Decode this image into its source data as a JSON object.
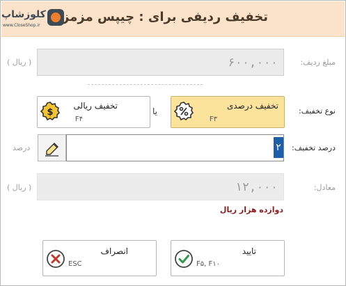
{
  "header": {
    "title": "تخفیف ردیفی برای : چیپس مزمز",
    "logo_text": "کلوزشاپ",
    "logo_sub": "www.CloseShop.ir"
  },
  "row_amount": {
    "label": "مبلغ ردیف:",
    "value": "۶۰۰,۰۰۰",
    "unit": "( ریال )"
  },
  "discount_type": {
    "label": "نوع تخفیف:",
    "or": "یا",
    "percent": {
      "label": "تخفیف درصدی",
      "key": "F۳",
      "selected": true
    },
    "rial": {
      "label": "تخفیف ریالی",
      "key": "F۴",
      "selected": false
    }
  },
  "discount_percent": {
    "label": "درصد تخفیف:",
    "value": "۲",
    "unit": "درصد"
  },
  "equivalent": {
    "label": "معادل:",
    "value": "۱۲,۰۰۰",
    "unit": "( ریال )",
    "words": "دوازده هزار  ریال"
  },
  "buttons": {
    "confirm": {
      "label": "تایید",
      "key": "F۵, F۱۰"
    },
    "cancel": {
      "label": "انصراف",
      "key": "ESC"
    }
  },
  "colors": {
    "header_bg": "#fbe3cb",
    "selected_option_bg": "#fbe39c",
    "words_color": "#8b1a1a",
    "confirm_green": "#2e9a4a",
    "cancel_red": "#c0392b",
    "caret_blue": "#1d5fa8"
  }
}
